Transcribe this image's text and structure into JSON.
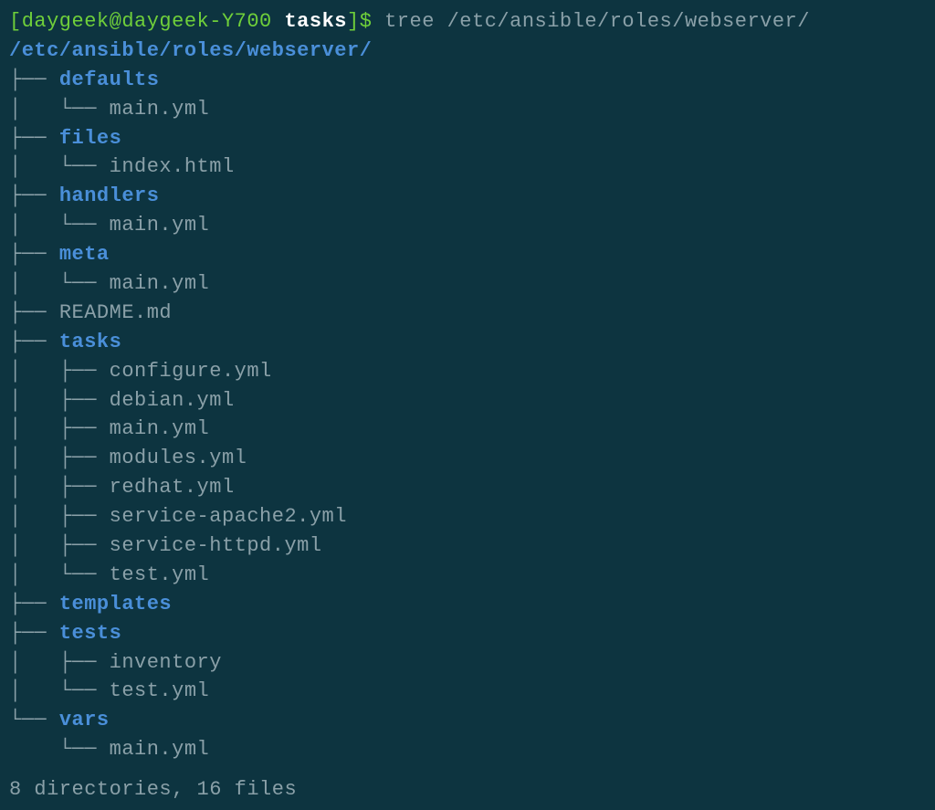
{
  "prompt": {
    "open_bracket": "[",
    "user": "daygeek",
    "at": "@",
    "host": "daygeek-Y700",
    "sep": " ",
    "cwd": "tasks",
    "close_bracket": "]",
    "dollar": "$",
    "command": " tree /etc/ansible/roles/webserver/"
  },
  "path_heading": "/etc/ansible/roles/webserver/",
  "tree": [
    {
      "branch": "├── ",
      "name": "defaults",
      "type": "dir"
    },
    {
      "branch": "│   └── ",
      "name": "main.yml",
      "type": "file"
    },
    {
      "branch": "├── ",
      "name": "files",
      "type": "dir"
    },
    {
      "branch": "│   └── ",
      "name": "index.html",
      "type": "file"
    },
    {
      "branch": "├── ",
      "name": "handlers",
      "type": "dir"
    },
    {
      "branch": "│   └── ",
      "name": "main.yml",
      "type": "file"
    },
    {
      "branch": "├── ",
      "name": "meta",
      "type": "dir"
    },
    {
      "branch": "│   └── ",
      "name": "main.yml",
      "type": "file"
    },
    {
      "branch": "├── ",
      "name": "README.md",
      "type": "file"
    },
    {
      "branch": "├── ",
      "name": "tasks",
      "type": "dir"
    },
    {
      "branch": "│   ├── ",
      "name": "configure.yml",
      "type": "file"
    },
    {
      "branch": "│   ├── ",
      "name": "debian.yml",
      "type": "file"
    },
    {
      "branch": "│   ├── ",
      "name": "main.yml",
      "type": "file"
    },
    {
      "branch": "│   ├── ",
      "name": "modules.yml",
      "type": "file"
    },
    {
      "branch": "│   ├── ",
      "name": "redhat.yml",
      "type": "file"
    },
    {
      "branch": "│   ├── ",
      "name": "service-apache2.yml",
      "type": "file"
    },
    {
      "branch": "│   ├── ",
      "name": "service-httpd.yml",
      "type": "file"
    },
    {
      "branch": "│   └── ",
      "name": "test.yml",
      "type": "file"
    },
    {
      "branch": "├── ",
      "name": "templates",
      "type": "dir"
    },
    {
      "branch": "├── ",
      "name": "tests",
      "type": "dir"
    },
    {
      "branch": "│   ├── ",
      "name": "inventory",
      "type": "file"
    },
    {
      "branch": "│   └── ",
      "name": "test.yml",
      "type": "file"
    },
    {
      "branch": "└── ",
      "name": "vars",
      "type": "dir"
    },
    {
      "branch": "    └── ",
      "name": "main.yml",
      "type": "file"
    }
  ],
  "summary": "8 directories, 16 files"
}
